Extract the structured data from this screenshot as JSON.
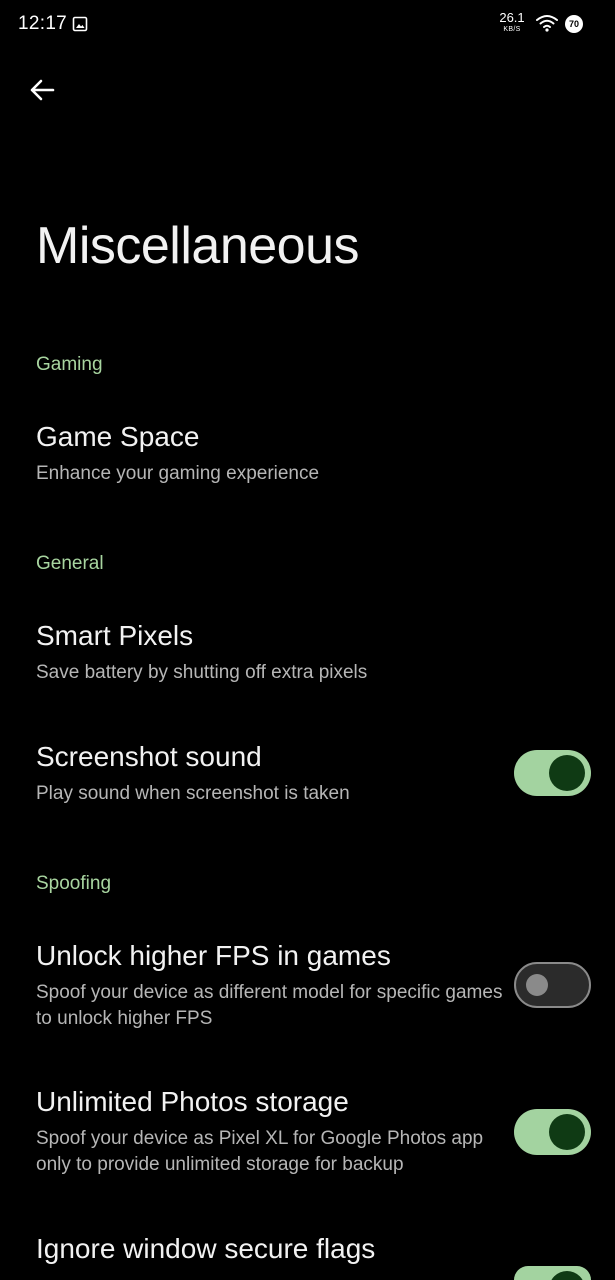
{
  "status_bar": {
    "time": "12:17",
    "net_speed_value": "26.1",
    "net_speed_unit": "KB/S",
    "battery_level": "70"
  },
  "page": {
    "title": "Miscellaneous"
  },
  "sections": {
    "gaming": {
      "header": "Gaming",
      "game_space": {
        "title": "Game Space",
        "summary": "Enhance your gaming experience"
      }
    },
    "general": {
      "header": "General",
      "smart_pixels": {
        "title": "Smart Pixels",
        "summary": "Save battery by shutting off extra pixels"
      },
      "screenshot_sound": {
        "title": "Screenshot sound",
        "summary": "Play sound when screenshot is taken",
        "enabled": true
      }
    },
    "spoofing": {
      "header": "Spoofing",
      "higher_fps": {
        "title": "Unlock higher FPS in games",
        "summary": "Spoof your device as different model for specific games to unlock higher FPS",
        "enabled": false
      },
      "photos_storage": {
        "title": "Unlimited Photos storage",
        "summary": "Spoof your device as Pixel XL for Google Photos app only to provide unlimited storage for backup",
        "enabled": true
      },
      "secure_flags": {
        "title": "Ignore window secure flags",
        "enabled": true
      }
    }
  },
  "colors": {
    "background": "#000000",
    "section_header": "#a8d5a0",
    "switch_on_track": "#a3d3a0",
    "switch_on_thumb": "#0f3a14",
    "switch_off_outline": "#8a8a8a"
  },
  "icons": {
    "back": "arrow-back-icon",
    "notification": "image-icon",
    "wifi": "wifi-icon",
    "battery": "battery-icon"
  }
}
